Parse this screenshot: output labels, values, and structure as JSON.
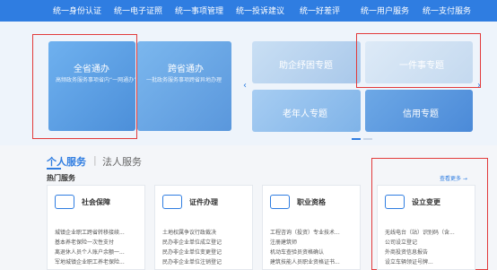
{
  "topnav": {
    "items": [
      "统一身份认证",
      "统一电子证照",
      "统一事项管理",
      "统一投诉建议",
      "统一好差评",
      "统一用户服务",
      "统一支付服务"
    ]
  },
  "banner": {
    "cards": [
      {
        "title": "全省通办",
        "subtitle": "高频政务服务事项省内“一网通办”"
      },
      {
        "title": "跨省通办",
        "subtitle": "一批政务服务事项跨省异地办理"
      },
      {
        "title": "助企纾困专题",
        "subtitle": ""
      },
      {
        "title": "一件事专题",
        "subtitle": ""
      },
      {
        "title": "老年人专题",
        "subtitle": ""
      },
      {
        "title": "信用专题",
        "subtitle": ""
      }
    ],
    "prev": "‹",
    "next": "›"
  },
  "tabs": {
    "personal": "个人服务",
    "separator": "|",
    "legal": "法人服务"
  },
  "hot": {
    "label": "热门服务",
    "more": "查看更多 →"
  },
  "services": [
    {
      "name": "社会保障",
      "items": [
        "城镇企业职工跨省转移接续...",
        "基本养老保险一次性支付",
        "离退休人员个人账户余额一...",
        "军地城镇企业职工养老保险..."
      ]
    },
    {
      "name": "证件办理",
      "items": [
        "土地权属争议行政裁决",
        "民办非企业单位成立登记",
        "民办非企业单位变更登记",
        "民办非企业单位注销登记"
      ]
    },
    {
      "name": "职业资格",
      "items": [
        "工程咨询（投资）专业技术...",
        "注册建筑师",
        "机动车查验员资格确认",
        "建筑技能人员职业资格证书..."
      ]
    },
    {
      "name": "设立变更",
      "items": [
        "无线电台（站）识别码（含...",
        "公司设立登记",
        "外商投资信息报告",
        "设立车辆领证号牌..."
      ]
    }
  ]
}
